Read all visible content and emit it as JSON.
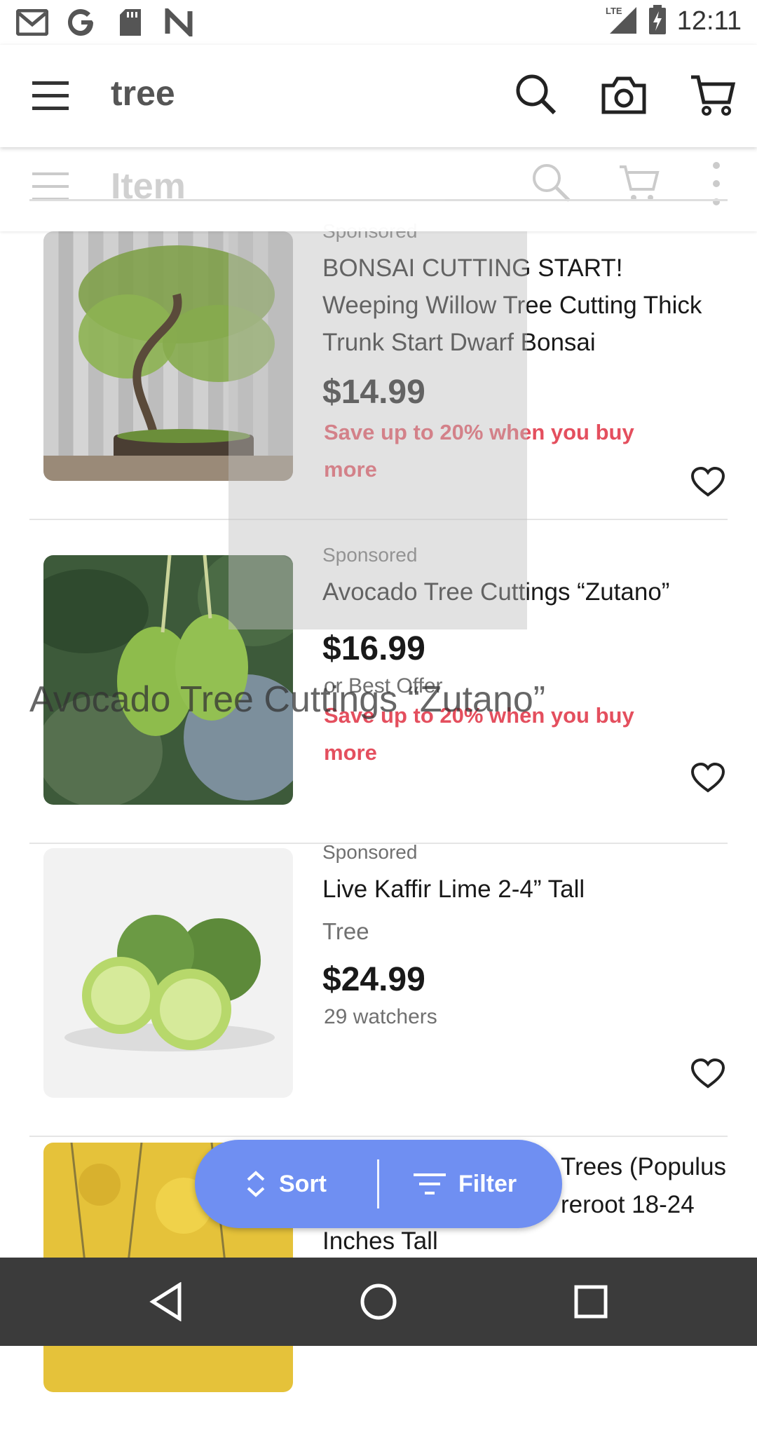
{
  "status_bar": {
    "time": "12:11",
    "left_icons": [
      "gmail-icon",
      "google-icon",
      "sd-card-icon",
      "n-app-icon"
    ],
    "network": "LTE"
  },
  "app_bar": {
    "title": "tree",
    "icons": [
      "menu-icon",
      "search-icon",
      "camera-icon",
      "cart-icon"
    ]
  },
  "ghost_header": {
    "title": "Item"
  },
  "listings": [
    {
      "sponsored": "Sponsored",
      "title": "BONSAI CUTTING START! Weeping Willow Tree Cutting Thick Trunk Start Dwarf Bonsai",
      "price": "$14.99",
      "promo": "Save up to 20% when you buy more"
    },
    {
      "sponsored": "Sponsored",
      "title": "Avocado Tree Cuttings “Zutano”",
      "price": "$16.99",
      "offer": "or Best Offer",
      "promo": "Save up to 20% when you buy more"
    },
    {
      "sponsored": "Sponsored",
      "title": "Live Kaffir Lime 2-4” Tall",
      "subtitle": "Tree",
      "price": "$24.99",
      "watchers": "29 watchers"
    },
    {
      "title_line1": "Trees (Populus",
      "title_line2": "reroot 18-24",
      "title_line3": "Inches Tall"
    }
  ],
  "overlay_text": "Avocado Tree Cuttings “Zutano”",
  "sort_filter": {
    "sort_label": "Sort",
    "filter_label": "Filter"
  },
  "colors": {
    "accent": "#6f8ff2",
    "promo_red": "#dd1e31",
    "nav_bg": "#3b3b3b"
  }
}
